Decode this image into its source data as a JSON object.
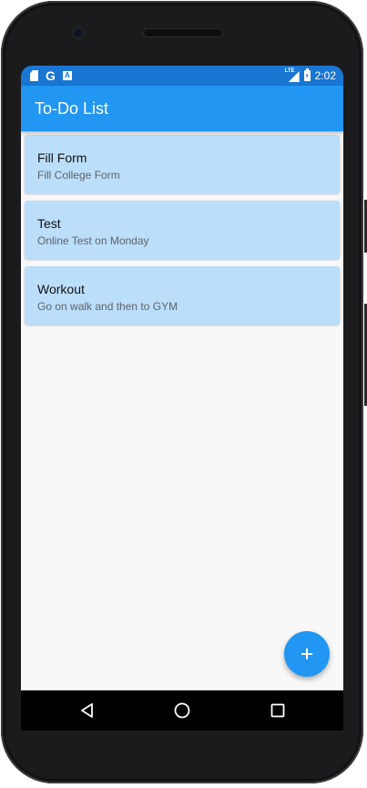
{
  "status_bar": {
    "time": "2:02",
    "google_glyph": "G",
    "a_glyph": "A",
    "network": "LTE",
    "icons": [
      "sd-card-icon",
      "google-icon",
      "a-notification-icon",
      "lte-signal-icon",
      "battery-charging-icon"
    ]
  },
  "app_bar": {
    "title": "To-Do List"
  },
  "tasks": [
    {
      "title": "Fill Form",
      "subtitle": "Fill College Form"
    },
    {
      "title": "Test",
      "subtitle": "Online Test on Monday"
    },
    {
      "title": "Workout",
      "subtitle": "Go on walk and then to GYM"
    }
  ],
  "fab": {
    "icon": "add-icon"
  },
  "nav_bar": {
    "icons": [
      "back-icon",
      "home-icon",
      "recent-apps-icon"
    ]
  },
  "colors": {
    "status_bar": "#1976d2",
    "app_bar": "#2196f3",
    "card": "#bbdefb",
    "fab": "#2196f3",
    "background": "#f8f8f8"
  }
}
